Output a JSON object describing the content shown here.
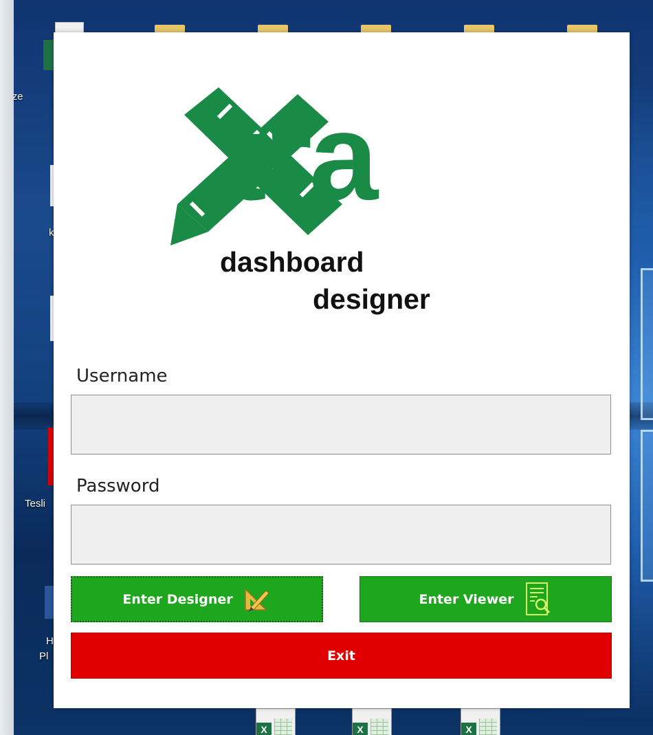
{
  "desktop": {
    "left_labels": [
      "Öze",
      "k",
      "Tesli",
      "H",
      "Pl"
    ]
  },
  "dialog": {
    "logo": {
      "word": "tra",
      "line1": "dashboard",
      "line2": "designer",
      "brand_color": "#1a8a47"
    },
    "username": {
      "label": "Username",
      "value": "",
      "placeholder": ""
    },
    "password": {
      "label": "Password",
      "value": "",
      "placeholder": ""
    },
    "buttons": {
      "designer_label": "Enter Designer",
      "designer_icon": "ruler-pencil-icon",
      "viewer_label": "Enter Viewer",
      "viewer_icon": "report-search-icon",
      "exit_label": "Exit"
    },
    "colors": {
      "green": "#1ea61e",
      "red": "#e00000"
    }
  }
}
